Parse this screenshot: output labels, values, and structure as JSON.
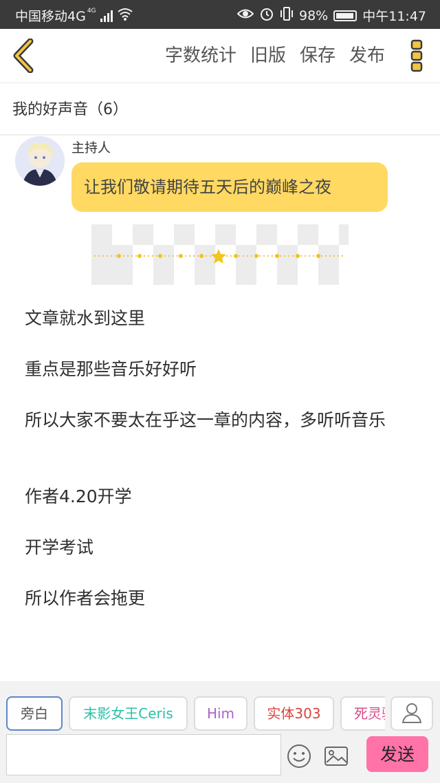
{
  "status_bar": {
    "carrier": "中国移动4G",
    "network_badge": "4G",
    "battery": "98%",
    "time": "中午11:47",
    "icons": [
      "signal-bars-icon",
      "wifi-icon",
      "eye-icon",
      "alarm-icon",
      "vibrate-icon",
      "battery-icon"
    ]
  },
  "toolbar": {
    "back_icon": "chevron-left-icon",
    "actions": [
      "字数统计",
      "旧版",
      "保存",
      "发布"
    ],
    "more_icon": "more-vertical-icon",
    "accent": "#f4c543"
  },
  "chapter": {
    "title": "我的好声音（6）"
  },
  "dialogue": {
    "speaker": "主持人",
    "message": "让我们敬请期待五天后的巅峰之夜",
    "bubble_color": "#ffd962"
  },
  "paragraphs": [
    "文章就水到这里",
    "重点是那些音乐好好听",
    "所以大家不要太在乎这一章的内容，多听听音乐",
    "作者4.20开学",
    "开学考试",
    "所以作者会拖更"
  ],
  "roles": [
    {
      "label": "旁白",
      "color": "#555555"
    },
    {
      "label": "末影女王Ceris",
      "color": "#2bbfa6"
    },
    {
      "label": "Him",
      "color": "#b062c9"
    },
    {
      "label": "实体303",
      "color": "#d9443a"
    },
    {
      "label": "死灵骑",
      "color": "#d94a8a"
    }
  ],
  "input": {
    "placeholder": "",
    "value": ""
  },
  "send_label": "发送",
  "send_color": "#ff73a8"
}
